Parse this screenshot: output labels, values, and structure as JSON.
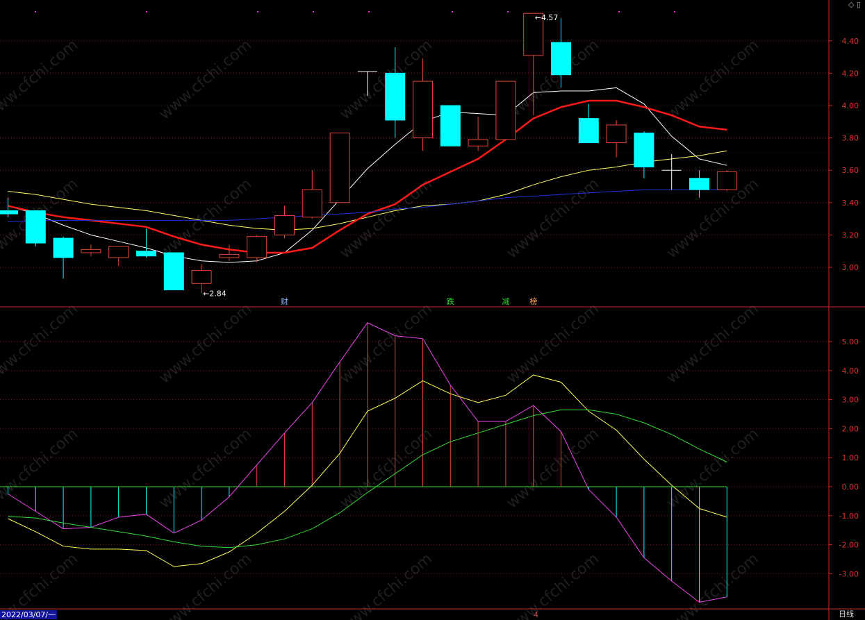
{
  "toolbar": {
    "diamond_icon": "diamond-icon",
    "panel_icon": "panel-toggle-icon"
  },
  "footer": {
    "date": "2022/03/07/一",
    "period": "日线",
    "cursor_marker": "4"
  },
  "colors": {
    "up": "#e0463c",
    "down": "#00ffff",
    "ma5": "#ffffff",
    "ma10": "#ffff66",
    "ma20": "#ff1a1a",
    "ma60": "#2233dd",
    "grid": "#7a1a1a",
    "axis": "#c62828",
    "dif": "#ffff55",
    "dea": "#33dd33",
    "macd_line": "#ee44ee"
  },
  "event_tags": [
    {
      "label": "财",
      "index": 10,
      "color": "#8ab4ff"
    },
    {
      "label": "跌",
      "index": 16,
      "color": "#33dd33"
    },
    {
      "label": "减",
      "index": 18,
      "color": "#33dd33"
    },
    {
      "label": "榜",
      "index": 19,
      "color": "#ffaa55"
    }
  ],
  "chart_data": [
    {
      "type": "candlestick",
      "title": "",
      "ylim": [
        2.8,
        4.62
      ],
      "yticks": [
        "3.00",
        "3.20",
        "3.40",
        "3.60",
        "3.80",
        "4.00",
        "4.20",
        "4.40"
      ],
      "grid": true,
      "annotations": [
        {
          "text": "4.57",
          "index": 19,
          "value": 4.57,
          "kind": "high"
        },
        {
          "text": "2.84",
          "index": 7,
          "value": 2.84,
          "kind": "low"
        }
      ],
      "candles": [
        {
          "o": 3.35,
          "h": 3.43,
          "l": 3.31,
          "c": 3.33
        },
        {
          "o": 3.35,
          "h": 3.35,
          "l": 3.13,
          "c": 3.15
        },
        {
          "o": 3.18,
          "h": 3.19,
          "l": 2.93,
          "c": 3.06
        },
        {
          "o": 3.09,
          "h": 3.14,
          "l": 3.07,
          "c": 3.11
        },
        {
          "o": 3.06,
          "h": 3.13,
          "l": 3.01,
          "c": 3.13
        },
        {
          "o": 3.1,
          "h": 3.24,
          "l": 3.06,
          "c": 3.07
        },
        {
          "o": 3.09,
          "h": 3.09,
          "l": 2.86,
          "c": 2.86
        },
        {
          "o": 2.9,
          "h": 3.02,
          "l": 2.84,
          "c": 2.98
        },
        {
          "o": 3.06,
          "h": 3.14,
          "l": 3.04,
          "c": 3.08
        },
        {
          "o": 3.06,
          "h": 3.2,
          "l": 3.03,
          "c": 3.19
        },
        {
          "o": 3.2,
          "h": 3.38,
          "l": 3.18,
          "c": 3.32
        },
        {
          "o": 3.31,
          "h": 3.6,
          "l": 3.3,
          "c": 3.48
        },
        {
          "o": 3.4,
          "h": 3.4,
          "l": 3.4,
          "c": 3.83
        },
        {
          "o": 4.21,
          "h": 4.21,
          "l": 4.06,
          "c": 4.21
        },
        {
          "o": 4.2,
          "h": 4.36,
          "l": 3.8,
          "c": 3.91
        },
        {
          "o": 3.8,
          "h": 4.29,
          "l": 3.72,
          "c": 4.15
        },
        {
          "o": 4.0,
          "h": 4.0,
          "l": 3.75,
          "c": 3.75
        },
        {
          "o": 3.75,
          "h": 3.93,
          "l": 3.72,
          "c": 3.79
        },
        {
          "o": 3.79,
          "h": 4.15,
          "l": 3.79,
          "c": 4.15
        },
        {
          "o": 4.31,
          "h": 4.57,
          "l": 3.94,
          "c": 4.57
        },
        {
          "o": 4.39,
          "h": 4.54,
          "l": 4.11,
          "c": 4.19
        },
        {
          "o": 3.92,
          "h": 4.01,
          "l": 3.77,
          "c": 3.77
        },
        {
          "o": 3.77,
          "h": 3.91,
          "l": 3.68,
          "c": 3.88
        },
        {
          "o": 3.83,
          "h": 3.84,
          "l": 3.55,
          "c": 3.62
        },
        {
          "o": 3.6,
          "h": 3.7,
          "l": 3.48,
          "c": 3.6
        },
        {
          "o": 3.55,
          "h": 3.6,
          "l": 3.43,
          "c": 3.48
        },
        {
          "o": 3.48,
          "h": 3.6,
          "l": 3.47,
          "c": 3.59
        }
      ],
      "series": [
        {
          "key": "ma5",
          "values": [
            3.38,
            3.33,
            3.26,
            3.2,
            3.16,
            3.12,
            3.07,
            3.04,
            3.03,
            3.04,
            3.09,
            3.23,
            3.42,
            3.61,
            3.76,
            3.9,
            3.96,
            3.95,
            3.94,
            4.08,
            4.09,
            4.09,
            4.11,
            4.01,
            3.81,
            3.67,
            3.63
          ]
        },
        {
          "key": "ma10",
          "values": [
            3.47,
            3.45,
            3.42,
            3.39,
            3.37,
            3.35,
            3.32,
            3.29,
            3.26,
            3.24,
            3.23,
            3.24,
            3.27,
            3.31,
            3.35,
            3.38,
            3.39,
            3.41,
            3.45,
            3.51,
            3.56,
            3.6,
            3.62,
            3.65,
            3.67,
            3.69,
            3.72
          ]
        },
        {
          "key": "ma20",
          "values": [
            3.38,
            3.34,
            3.31,
            3.29,
            3.27,
            3.25,
            3.19,
            3.14,
            3.11,
            3.09,
            3.09,
            3.12,
            3.23,
            3.33,
            3.39,
            3.51,
            3.59,
            3.67,
            3.79,
            3.92,
            3.99,
            4.03,
            4.03,
            3.99,
            3.94,
            3.87,
            3.85
          ]
        },
        {
          "key": "ma60",
          "values": [
            3.28,
            3.29,
            3.29,
            3.29,
            3.29,
            3.29,
            3.29,
            3.29,
            3.29,
            3.3,
            3.31,
            3.32,
            3.33,
            3.34,
            3.36,
            3.37,
            3.39,
            3.41,
            3.43,
            3.44,
            3.45,
            3.46,
            3.47,
            3.48,
            3.48,
            3.48,
            3.48
          ]
        }
      ]
    },
    {
      "type": "bar",
      "title": "",
      "ylim": [
        -4.1,
        6.0
      ],
      "yticks": [
        "-3.00",
        "-2.00",
        "-1.00",
        "0.00",
        "1.00",
        "2.00",
        "3.00",
        "4.00",
        "5.00"
      ],
      "grid": true,
      "macd": [
        -0.25,
        -0.85,
        -1.45,
        -1.4,
        -1.05,
        -0.95,
        -1.6,
        -1.15,
        -0.35,
        0.75,
        1.85,
        2.9,
        4.3,
        5.65,
        5.2,
        5.1,
        3.5,
        2.25,
        2.25,
        2.8,
        1.9,
        -0.1,
        -1.05,
        -2.45,
        -3.25,
        -3.98,
        -3.8
      ],
      "series": [
        {
          "key": "dif",
          "values": [
            -1.1,
            -1.55,
            -2.05,
            -2.15,
            -2.15,
            -2.2,
            -2.75,
            -2.65,
            -2.25,
            -1.6,
            -0.85,
            0.05,
            1.15,
            2.6,
            3.05,
            3.65,
            3.2,
            2.9,
            3.15,
            3.85,
            3.6,
            2.6,
            1.95,
            0.95,
            0.05,
            -0.75,
            -1.05
          ]
        },
        {
          "key": "dea",
          "values": [
            -1.02,
            -1.08,
            -1.25,
            -1.4,
            -1.55,
            -1.7,
            -1.9,
            -2.05,
            -2.1,
            -2.0,
            -1.8,
            -1.45,
            -0.9,
            -0.2,
            0.45,
            1.1,
            1.55,
            1.85,
            2.15,
            2.45,
            2.65,
            2.65,
            2.5,
            2.2,
            1.8,
            1.3,
            0.85
          ]
        }
      ]
    }
  ]
}
